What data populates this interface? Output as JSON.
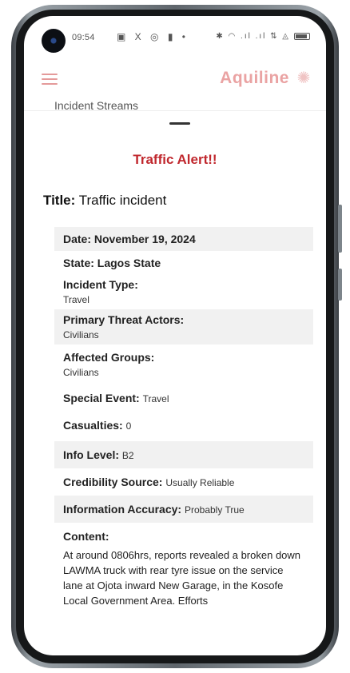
{
  "status_bar": {
    "time": "09:54",
    "left_icons": "▣ X ◎ ▮ •",
    "right_icons": "✱ ◠ .ıl .ıl ⇅ ◬"
  },
  "app": {
    "logo_text": "Aquiline",
    "menu_icon": "hamburger-icon"
  },
  "partial_heading": "Incident Streams",
  "alert": {
    "title": "Traffic Alert!!",
    "title_label": "Title:",
    "title_value": "Traffic incident",
    "fields": [
      {
        "label": "Date: November 19, 2024",
        "value": ""
      },
      {
        "label": "State: Lagos State",
        "value": ""
      },
      {
        "label": "Incident Type:",
        "value": "Travel"
      },
      {
        "label": "Primary Threat Actors:",
        "value": "Civilians"
      },
      {
        "label": "Affected Groups:",
        "value": "Civilians"
      },
      {
        "label": "Special Event:",
        "value": "Travel"
      },
      {
        "label": "Casualties:",
        "value": "0"
      },
      {
        "label": "Info Level:",
        "value": "B2"
      },
      {
        "label": "Credibility Source:",
        "value": "Usually Reliable"
      },
      {
        "label": "Information Accuracy:",
        "value": "Probably True"
      }
    ],
    "content_label": "Content:",
    "content_text": "At around 0806hrs, reports revealed a broken down LAWMA truck with rear tyre issue on the service lane at Ojota inward New Garage, in the Kosofe Local Government Area. Efforts"
  },
  "colors": {
    "accent": "#c0272d",
    "logo": "#eaa3a3"
  }
}
